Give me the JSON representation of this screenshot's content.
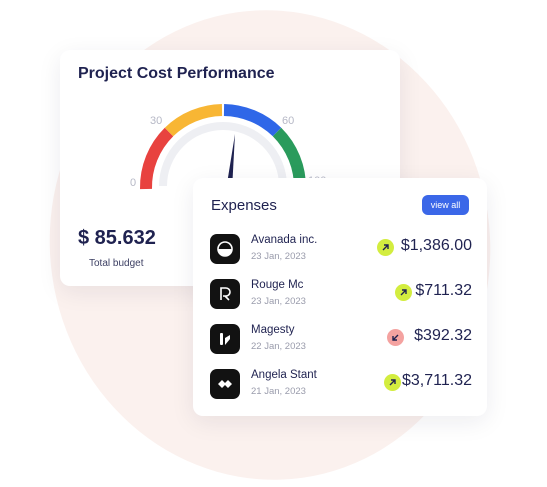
{
  "colors": {
    "gauge_red": "#e8423f",
    "gauge_yellow": "#f8b634",
    "gauge_blue": "#2f67e8",
    "gauge_green": "#2a9b5c",
    "trend_up": "#d3ed3f",
    "trend_down": "#f4a2a0",
    "button_blue": "#3b67e8",
    "text_dark": "#1f2250"
  },
  "performance": {
    "title": "Project Cost Performance",
    "gauge_labels": {
      "low": "0",
      "mid_low": "30",
      "mid_high": "60",
      "high": "100"
    },
    "budget_value": "$ 85.632",
    "budget_label": "Total budget"
  },
  "expenses": {
    "title": "Expenses",
    "view_all_label": "view all",
    "rows": [
      {
        "name": "Avanada inc.",
        "date": "23 Jan, 2023",
        "amount": "$1,386.00",
        "trend": "up",
        "logo_icon": "avanada-logo-icon"
      },
      {
        "name": "Rouge Mc",
        "date": "23 Jan, 2023",
        "amount": "$711.32",
        "trend": "up",
        "logo_icon": "rouge-logo-icon"
      },
      {
        "name": "Magesty",
        "date": "22 Jan, 2023",
        "amount": "$392.32",
        "trend": "down",
        "logo_icon": "magesty-logo-icon"
      },
      {
        "name": "Angela Stant",
        "date": "21 Jan, 2023",
        "amount": "$3,711.32",
        "trend": "up",
        "logo_icon": "angela-logo-icon"
      }
    ]
  }
}
